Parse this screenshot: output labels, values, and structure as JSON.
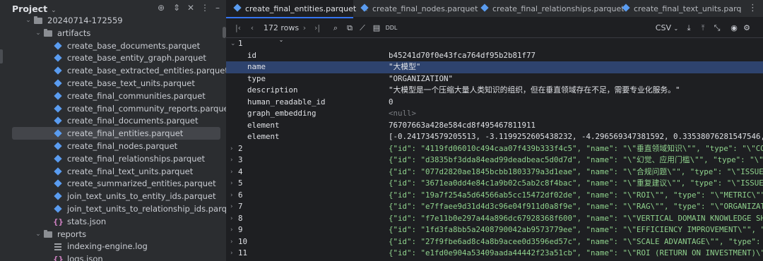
{
  "project": {
    "title": "Project",
    "tree": [
      {
        "label": "20240714-172559",
        "kind": "folder",
        "indent": 1,
        "caret": "v"
      },
      {
        "label": "artifacts",
        "kind": "folder",
        "indent": 2,
        "caret": "v"
      },
      {
        "label": "create_base_documents.parquet",
        "kind": "parquet",
        "indent": 3
      },
      {
        "label": "create_base_entity_graph.parquet",
        "kind": "parquet",
        "indent": 3
      },
      {
        "label": "create_base_extracted_entities.parquet",
        "kind": "parquet",
        "indent": 3
      },
      {
        "label": "create_base_text_units.parquet",
        "kind": "parquet",
        "indent": 3
      },
      {
        "label": "create_final_communities.parquet",
        "kind": "parquet",
        "indent": 3
      },
      {
        "label": "create_final_community_reports.parquet",
        "kind": "parquet",
        "indent": 3
      },
      {
        "label": "create_final_documents.parquet",
        "kind": "parquet",
        "indent": 3
      },
      {
        "label": "create_final_entities.parquet",
        "kind": "parquet",
        "indent": 3,
        "selected": true
      },
      {
        "label": "create_final_nodes.parquet",
        "kind": "parquet",
        "indent": 3
      },
      {
        "label": "create_final_relationships.parquet",
        "kind": "parquet",
        "indent": 3
      },
      {
        "label": "create_final_text_units.parquet",
        "kind": "parquet",
        "indent": 3
      },
      {
        "label": "create_summarized_entities.parquet",
        "kind": "parquet",
        "indent": 3
      },
      {
        "label": "join_text_units_to_entity_ids.parquet",
        "kind": "parquet",
        "indent": 3
      },
      {
        "label": "join_text_units_to_relationship_ids.parquet",
        "kind": "parquet",
        "indent": 3
      },
      {
        "label": "stats.json",
        "kind": "json",
        "indent": 3
      },
      {
        "label": "reports",
        "kind": "folder",
        "indent": 2,
        "caret": "v"
      },
      {
        "label": "indexing-engine.log",
        "kind": "log",
        "indent": 3
      },
      {
        "label": "logs.json",
        "kind": "json",
        "indent": 3
      }
    ]
  },
  "tabs": [
    {
      "label": "create_final_entities.parquet",
      "active": true
    },
    {
      "label": "create_final_nodes.parquet"
    },
    {
      "label": "create_final_relationships.parquet"
    },
    {
      "label": "create_final_text_units.parq"
    }
  ],
  "toolbar": {
    "rows_label": "172 rows",
    "ddl_label": "DDL",
    "export_format": "CSV"
  },
  "record": {
    "index": "1",
    "fields": [
      {
        "key": "id",
        "value": "b45241d70f0e43fca764df95b2b81f77"
      },
      {
        "key": "name",
        "value": "\"大模型\"",
        "selected": true
      },
      {
        "key": "type",
        "value": "\"ORGANIZATION\""
      },
      {
        "key": "description",
        "value": "\"大模型是一个压缩大量人类知识的组织，但在垂直领域存在不足，需要专业化服务。\""
      },
      {
        "key": "human_readable_id",
        "value": "0"
      },
      {
        "key": "graph_embedding",
        "value": "<null>",
        "null": true
      },
      {
        "key": "element",
        "value": "76707663a428e584cd8f495467811911"
      },
      {
        "key": "element",
        "value": "[-0.241734579205513, -3.1199252605438232, -4.296569347381592, 0.33538076281547546, -1.…"
      }
    ]
  },
  "rows": [
    {
      "index": "2",
      "value": "{\"id\": \"4119fd06010c494caa07f439b333f4c5\", \"name\": \"\\\"垂直领域知识\\\"\", \"type\": \"\\\"CONCEPT"
    },
    {
      "index": "3",
      "value": "{\"id\": \"d3835bf3dda84ead99deadbeac5d0d7d\", \"name\": \"\\\"幻觉、应用门槛\\\"\", \"type\": \"\\\"ISSUE"
    },
    {
      "index": "4",
      "value": "{\"id\": \"077d2820ae1845bcbb1803379a3d1eae\", \"name\": \"\\\"合规问题\\\"\", \"type\": \"\\\"ISSUE\\\"\","
    },
    {
      "index": "5",
      "value": "{\"id\": \"3671ea0dd4e84c1a9b02c5ab2c8f4bac\", \"name\": \"\\\"重复建议\\\"\", \"type\": \"\\\"ISSUE\\\"\","
    },
    {
      "index": "6",
      "value": "{\"id\": \"19a7f254a5d64566ab5cc15472df02de\", \"name\": \"\\\"ROI\\\"\", \"type\": \"\\\"METRIC\\\"\", \"de"
    },
    {
      "index": "7",
      "value": "{\"id\": \"e7ffaee9d31d4d3c96e04f911d0a8f9e\", \"name\": \"\\\"RAG\\\"\", \"type\": \"\\\"ORGANIZATION\\"
    },
    {
      "index": "8",
      "value": "{\"id\": \"f7e11b0e297a44a896dc67928368f600\", \"name\": \"\\\"VERTICAL DOMAIN KNOWLEDGE SHORTAG"
    },
    {
      "index": "9",
      "value": "{\"id\": \"1fd3fa8bb5a2408790042ab9573779ee\", \"name\": \"\\\"EFFICIENCY IMPROVEMENT\\\"\", \"type\""
    },
    {
      "index": "10",
      "value": "{\"id\": \"27f9fbe6ad8c4a8b9acee0d3596ed57c\", \"name\": \"\\\"SCALE ADVANTAGE\\\"\", \"type\": \"\\\"CO"
    },
    {
      "index": "11",
      "value": "{\"id\": \"e1fd0e904a53409aada44442f23a51cb\", \"name\": \"\\\"ROI (RETURN ON INVESTMENT)\\\"\", \"typ"
    }
  ]
}
